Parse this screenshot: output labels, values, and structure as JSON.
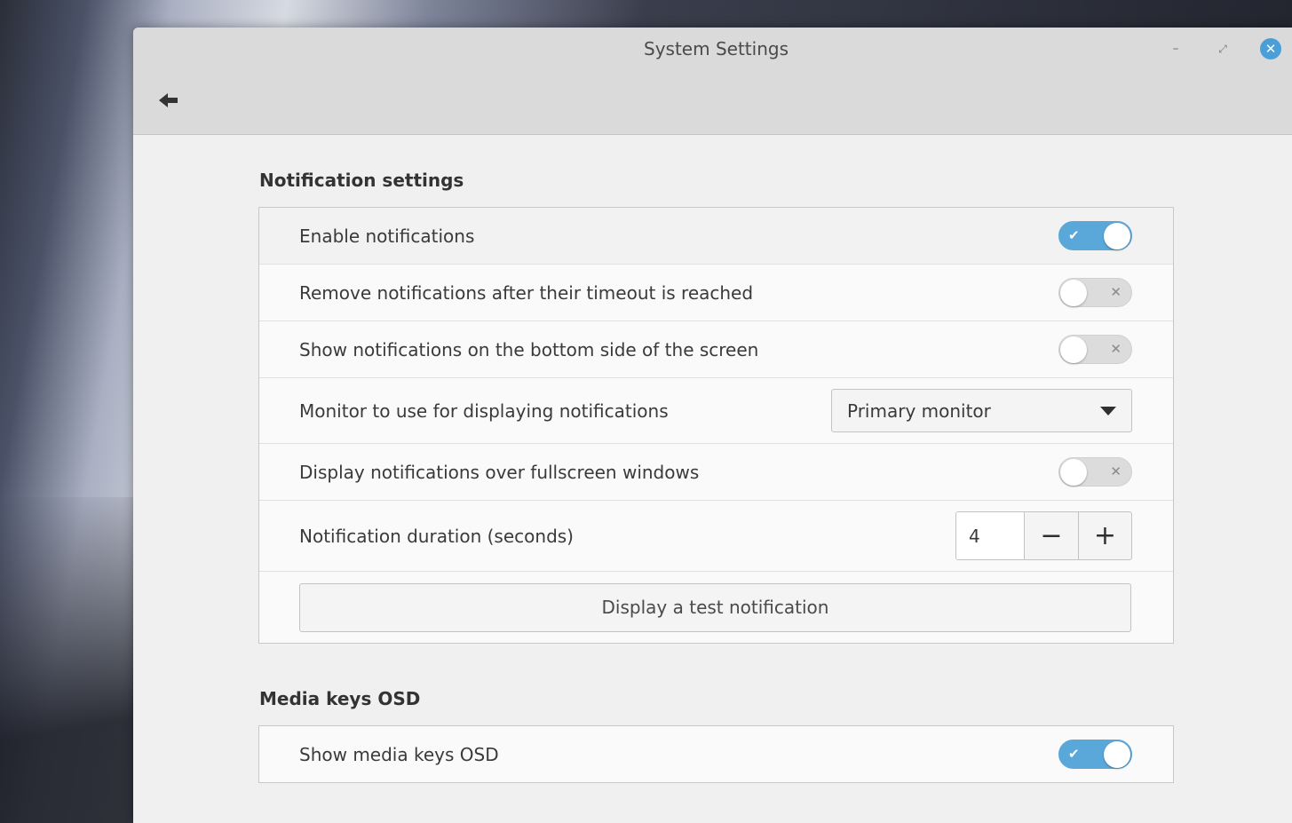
{
  "window": {
    "title": "System Settings",
    "minimize_symbol": "–",
    "maximize_symbol": "⤢",
    "close_symbol": "✕"
  },
  "notifications": {
    "section_title": "Notification settings",
    "enable_label": "Enable notifications",
    "enable_on": true,
    "remove_label": "Remove notifications after their timeout is reached",
    "remove_on": false,
    "bottom_label": "Show notifications on the bottom side of the screen",
    "bottom_on": false,
    "monitor_label": "Monitor to use for displaying notifications",
    "monitor_value": "Primary monitor",
    "fullscreen_label": "Display notifications over fullscreen windows",
    "fullscreen_on": false,
    "duration_label": "Notification duration (seconds)",
    "duration_value": "4",
    "decrement_symbol": "−",
    "increment_symbol": "+",
    "test_button_label": "Display a test notification"
  },
  "media": {
    "section_title": "Media keys OSD",
    "osd_label": "Show media keys OSD",
    "osd_on": true
  },
  "toggle_marks": {
    "on": "✔",
    "off": "✕"
  },
  "colors": {
    "accent": "#5aa7d9",
    "close_button": "#4a9fd8"
  }
}
